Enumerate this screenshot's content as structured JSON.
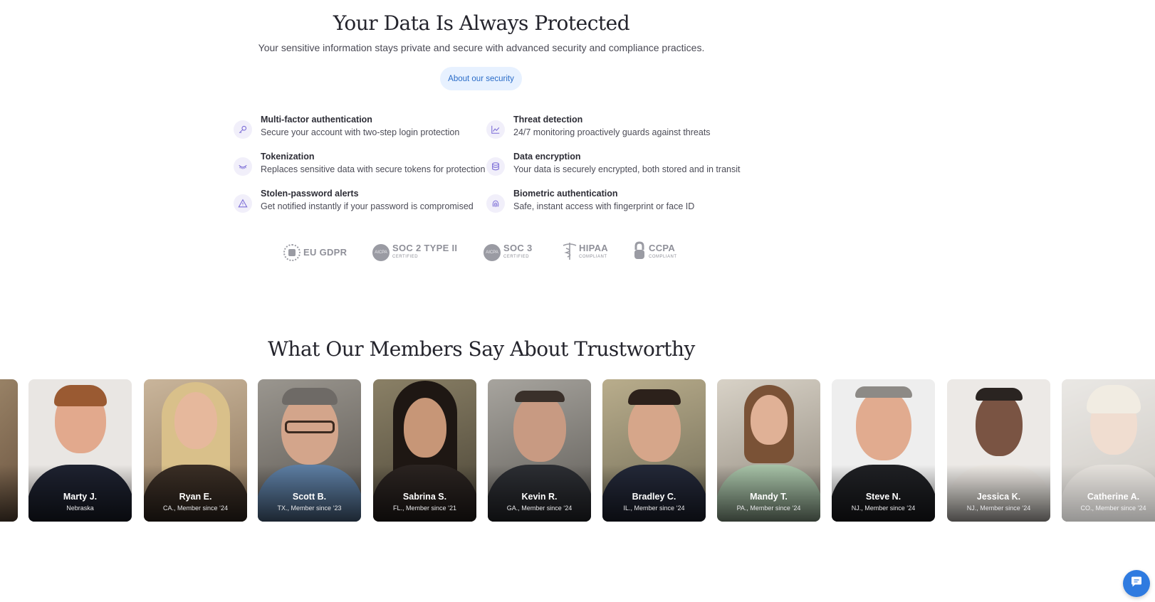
{
  "security": {
    "title": "Your Data Is Always Protected",
    "subtitle": "Your sensitive information stays private and secure with advanced security and compliance practices.",
    "button_label": "About our security",
    "features": [
      {
        "title": "Multi-factor authentication",
        "desc": "Secure your account with two-step login protection",
        "icon": "key-icon"
      },
      {
        "title": "Threat detection",
        "desc": "24/7 monitoring proactively guards against threats",
        "icon": "chart-line-icon"
      },
      {
        "title": "Tokenization",
        "desc": "Replaces sensitive data with secure tokens for protection",
        "icon": "eye-closed-icon"
      },
      {
        "title": "Data encryption",
        "desc": "Your data is securely encrypted, both stored and in transit",
        "icon": "database-icon"
      },
      {
        "title": "Stolen-password alerts",
        "desc": "Get notified instantly if your password is compromised",
        "icon": "warning-icon"
      },
      {
        "title": "Biometric authentication",
        "desc": "Safe, instant access with fingerprint or face ID",
        "icon": "fingerprint-icon"
      }
    ],
    "certifications": [
      {
        "name": "EU GDPR",
        "sub": ""
      },
      {
        "name": "SOC 2 TYPE II",
        "sub": "CERTIFIED"
      },
      {
        "name": "SOC 3",
        "sub": "CERTIFIED"
      },
      {
        "name": "HIPAA",
        "sub": "COMPLIANT"
      },
      {
        "name": "CCPA",
        "sub": "COMPLIANT"
      }
    ]
  },
  "members": {
    "title": "What Our Members Say About Trustworthy",
    "cards": [
      {
        "name": "Marty J.",
        "location": "Nebraska"
      },
      {
        "name": "Ryan E.",
        "location": "CA., Member since ‘24"
      },
      {
        "name": "Scott B.",
        "location": "TX., Member since ‘23"
      },
      {
        "name": "Sabrina S.",
        "location": "FL., Member since ‘21"
      },
      {
        "name": "Kevin R.",
        "location": "GA., Member since ‘24"
      },
      {
        "name": "Bradley C.",
        "location": "IL., Member since ‘24"
      },
      {
        "name": "Mandy T.",
        "location": "PA., Member since ‘24"
      },
      {
        "name": "Steve N.",
        "location": "NJ., Member since ‘24"
      },
      {
        "name": "Jessica K.",
        "location": "NJ., Member since ‘24"
      },
      {
        "name": "Catherine A.",
        "location": "CO., Member since ‘24"
      }
    ]
  },
  "chat": {
    "icon": "chat-bubble-icon"
  },
  "colors": {
    "accent": "#2f7be0",
    "button_bg": "#e7f1ff",
    "icon_bg": "#f1effa",
    "icon_stroke": "#7a6bd6"
  }
}
